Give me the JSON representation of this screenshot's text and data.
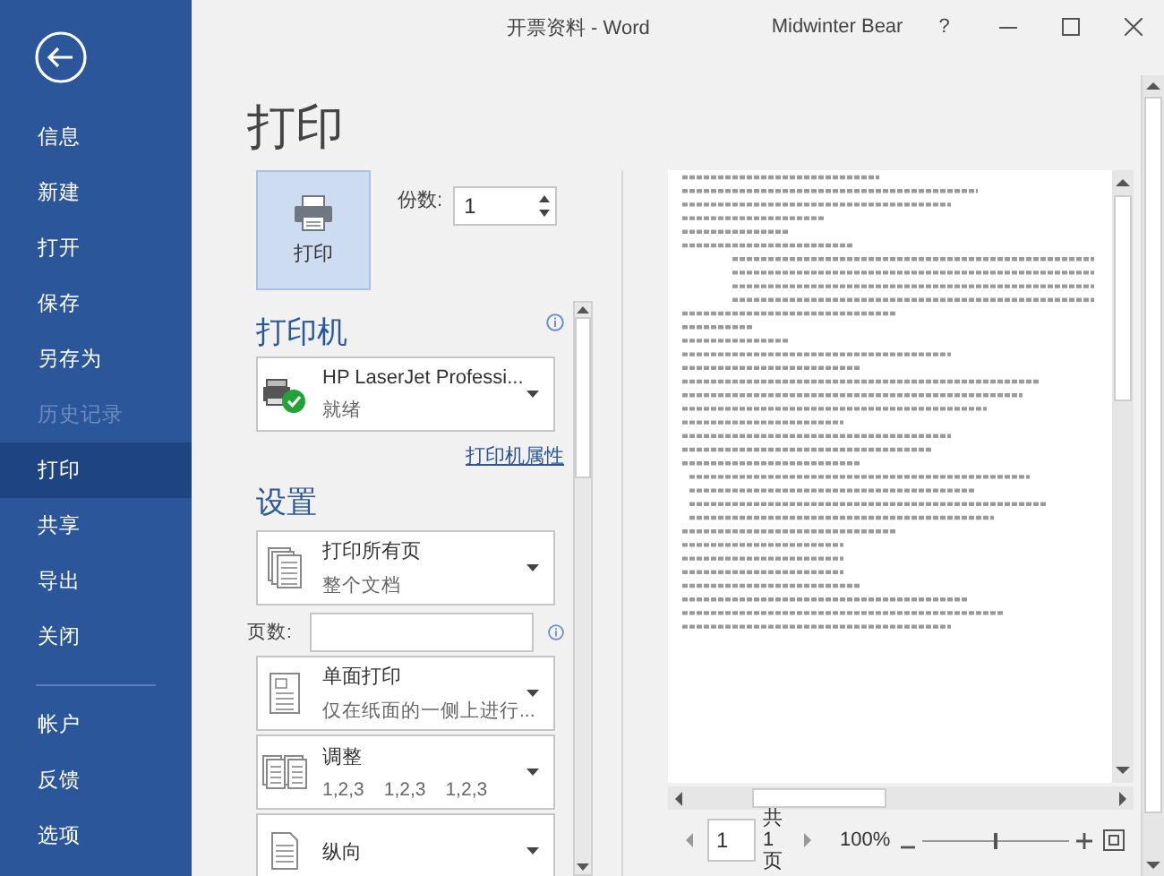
{
  "window": {
    "title": "开票资料 - Word",
    "user": "Midwinter Bear",
    "help": "?"
  },
  "sidebar": {
    "items": [
      {
        "label": "信息",
        "selected": false,
        "disabled": false
      },
      {
        "label": "新建",
        "selected": false,
        "disabled": false
      },
      {
        "label": "打开",
        "selected": false,
        "disabled": false
      },
      {
        "label": "保存",
        "selected": false,
        "disabled": false
      },
      {
        "label": "另存为",
        "selected": false,
        "disabled": false
      },
      {
        "label": "历史记录",
        "selected": false,
        "disabled": true
      },
      {
        "label": "打印",
        "selected": true,
        "disabled": false
      },
      {
        "label": "共享",
        "selected": false,
        "disabled": false
      },
      {
        "label": "导出",
        "selected": false,
        "disabled": false
      },
      {
        "label": "关闭",
        "selected": false,
        "disabled": false
      }
    ],
    "footer_items": [
      {
        "label": "帐户",
        "selected": false,
        "disabled": false
      },
      {
        "label": "反馈",
        "selected": false,
        "disabled": false
      },
      {
        "label": "选项",
        "selected": false,
        "disabled": false
      }
    ]
  },
  "heading": "打印",
  "print_button": {
    "label": "打印"
  },
  "copies": {
    "label": "份数:",
    "value": "1"
  },
  "printer": {
    "heading": "打印机",
    "name": "HP LaserJet Professi...",
    "status": "就绪",
    "ready": true,
    "properties_link": "打印机属性"
  },
  "settings": {
    "heading": "设置",
    "items": [
      {
        "kind": "all-pages",
        "title": "打印所有页",
        "subtitles": [
          "整个文档"
        ]
      },
      {
        "kind": "field",
        "label": "页数:"
      },
      {
        "kind": "one-sided",
        "title": "单面打印",
        "subtitles": [
          "仅在纸面的一侧上进行..."
        ]
      },
      {
        "kind": "collate",
        "title": "调整",
        "subtitles": [
          "1,2,3",
          "1,2,3",
          "1,2,3"
        ]
      },
      {
        "kind": "portrait",
        "title": "纵向"
      }
    ]
  },
  "preview": {
    "page": "1",
    "total": "共1页",
    "zoom": "100%",
    "level": 0.5
  }
}
